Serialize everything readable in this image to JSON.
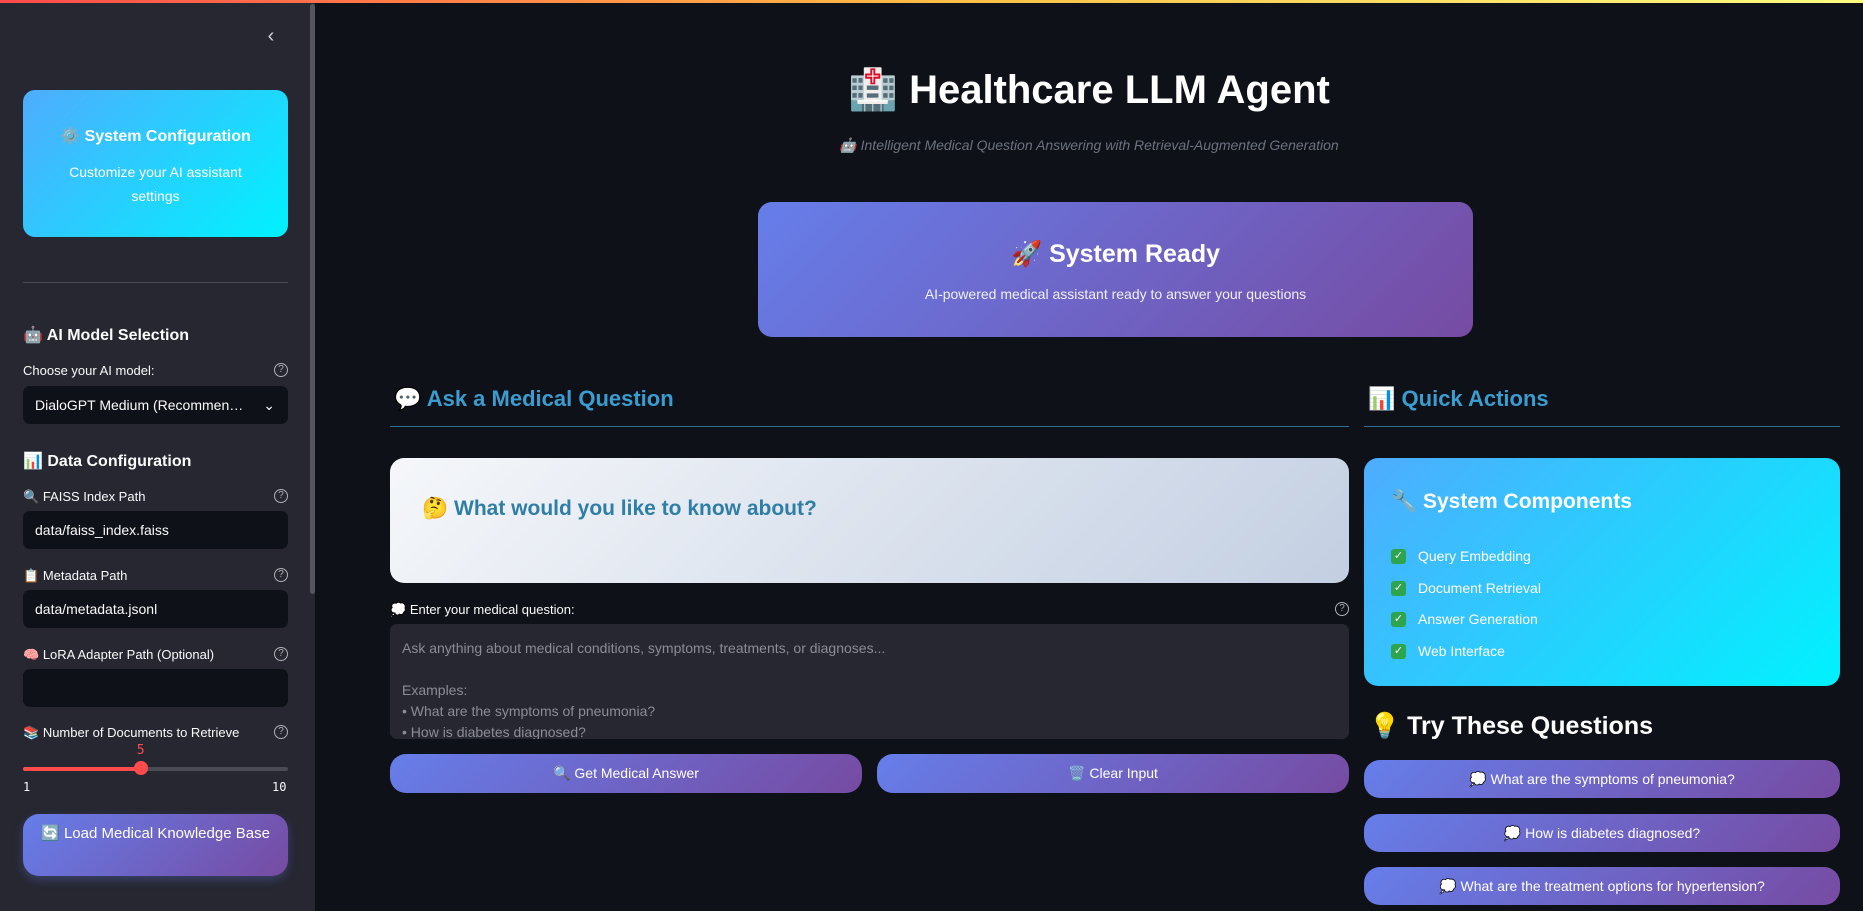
{
  "sidebar": {
    "collapse_icon": "‹",
    "config_card": {
      "icon": "⚙️",
      "title": "System Configuration",
      "subtitle": "Customize your AI assistant settings"
    },
    "model_section": {
      "icon": "🤖",
      "heading": "AI Model Selection",
      "label": "Choose your AI model:",
      "selected": "DialoGPT Medium (Recommen…",
      "chevron": "⌄"
    },
    "data_section": {
      "icon": "📊",
      "heading": "Data Configuration"
    },
    "faiss": {
      "icon": "🔍",
      "label": "FAISS Index Path",
      "value": "data/faiss_index.faiss"
    },
    "metadata": {
      "icon": "📋",
      "label": "Metadata Path",
      "value": "data/metadata.jsonl"
    },
    "lora": {
      "icon": "🧠",
      "label": "LoRA Adapter Path (Optional)",
      "value": ""
    },
    "docs": {
      "icon": "📚",
      "label": "Number of Documents to Retrieve",
      "value": 5,
      "value_text": "5",
      "min": "1",
      "max": "10"
    },
    "load_button": {
      "icon": "🔄",
      "label": "Load Medical Knowledge Base"
    },
    "help_glyph": "?"
  },
  "header": {
    "icon": "🏥",
    "title": "Healthcare LLM Agent",
    "subtitle_icon": "🤖",
    "subtitle": "Intelligent Medical Question Answering with Retrieval-Augmented Generation"
  },
  "status": {
    "icon": "🚀",
    "title": "System Ready",
    "subtitle": "AI-powered medical assistant ready to answer your questions"
  },
  "ask": {
    "section_icon": "💬",
    "section_title": "Ask a Medical Question",
    "card_icon": "🤔",
    "card_text": "What would you like to know about?",
    "input_icon": "💭",
    "input_label": "Enter your medical question:",
    "placeholder_lines": [
      "Ask anything about medical conditions, symptoms, treatments, or diagnoses...",
      "",
      "Examples:",
      "• What are the symptoms of pneumonia?",
      "• How is diabetes diagnosed?"
    ],
    "submit_icon": "🔍",
    "submit_label": "Get Medical Answer",
    "clear_icon": "🗑️",
    "clear_label": "Clear Input"
  },
  "quick": {
    "section_icon": "📊",
    "section_title": "Quick Actions",
    "components_icon": "🔧",
    "components_title": "System Components",
    "components": [
      "Query Embedding",
      "Document Retrieval",
      "Answer Generation",
      "Web Interface"
    ],
    "check_glyph": "✓",
    "try_icon": "💡",
    "try_title": "Try These Questions",
    "question_icon": "💭",
    "questions": [
      "What are the symptoms of pneumonia?",
      "How is diabetes diagnosed?",
      "What are the treatment options for hypertension?"
    ]
  },
  "colors": {
    "accent": "#ff4b4b",
    "section": "#3a9ccf",
    "purple_start": "#667eea",
    "purple_end": "#764ba2",
    "cyan_start": "#4facfe",
    "cyan_end": "#00f2fe"
  }
}
